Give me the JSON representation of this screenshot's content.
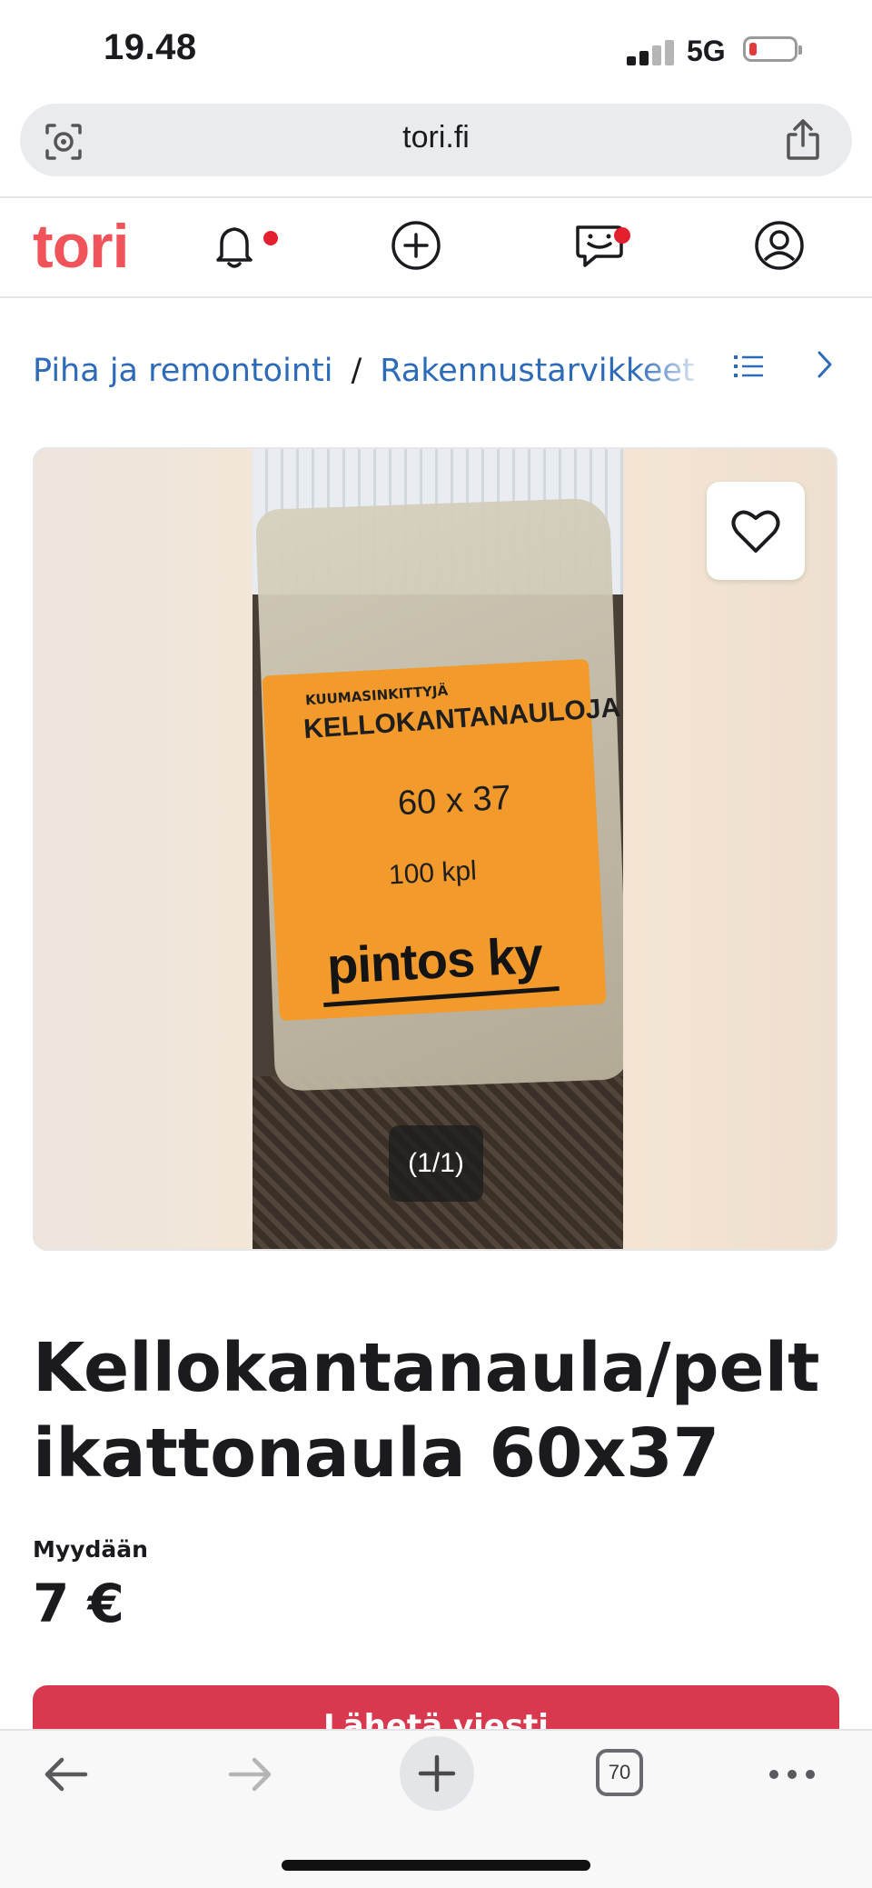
{
  "status_bar": {
    "time": "19.48",
    "network": "5G"
  },
  "browser": {
    "url": "tori.fi",
    "tab_count": "70"
  },
  "nav": {
    "logo": "tori"
  },
  "breadcrumb": {
    "items": [
      "Piha ja remontointi",
      "Rakennustarvikkeet ja"
    ],
    "separator": "/"
  },
  "gallery": {
    "counter": "(1/1)",
    "photo_text": {
      "small": "KUUMASINKITTYJÄ",
      "brand_line": "KELLOKANTANAULOJA",
      "size": "60 x 37",
      "qty": "100 kpl",
      "maker": "pintos ky"
    }
  },
  "listing": {
    "title": "Kellokantanaula/peltikattonaula 60x37",
    "price_label": "Myydään",
    "price": "7 €",
    "cta_label": "Lähetä viesti"
  },
  "colors": {
    "brand": "#f0535a",
    "link": "#2d6bb8",
    "cta": "#d8394e",
    "notification": "#e5202e"
  }
}
